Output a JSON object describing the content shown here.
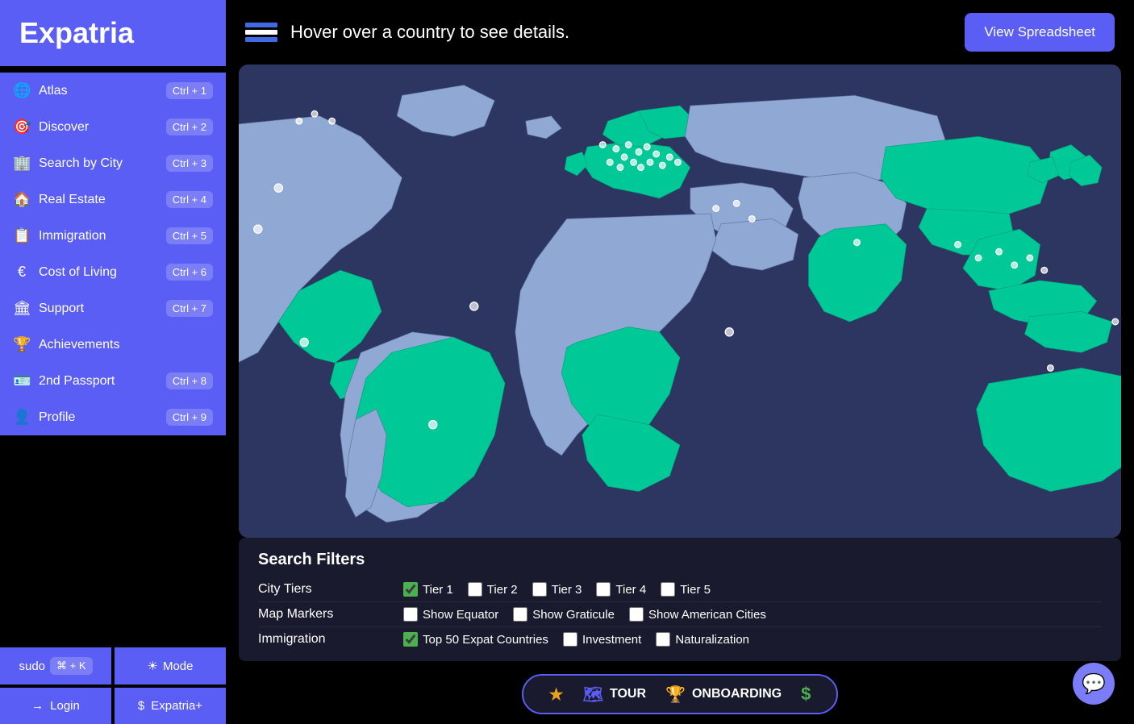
{
  "app": {
    "logo": "Expatria"
  },
  "sidebar": {
    "items": [
      {
        "id": "atlas",
        "label": "Atlas",
        "icon": "🌐",
        "shortcut": "Ctrl + 1"
      },
      {
        "id": "discover",
        "label": "Discover",
        "icon": "🎯",
        "shortcut": "Ctrl + 2"
      },
      {
        "id": "search-by-city",
        "label": "Search by City",
        "icon": "🏢",
        "shortcut": "Ctrl + 3"
      },
      {
        "id": "real-estate",
        "label": "Real Estate",
        "icon": "🏠",
        "shortcut": "Ctrl + 4"
      },
      {
        "id": "immigration",
        "label": "Immigration",
        "icon": "📋",
        "shortcut": "Ctrl + 5"
      },
      {
        "id": "cost-of-living",
        "label": "Cost of Living",
        "icon": "€",
        "shortcut": "Ctrl + 6"
      },
      {
        "id": "support",
        "label": "Support",
        "icon": "🏛",
        "shortcut": "Ctrl + 7"
      },
      {
        "id": "achievements",
        "label": "Achievements",
        "icon": "🏆",
        "shortcut": null
      },
      {
        "id": "2nd-passport",
        "label": "2nd Passport",
        "icon": "🪪",
        "shortcut": "Ctrl + 8"
      },
      {
        "id": "profile",
        "label": "Profile",
        "icon": "👤",
        "shortcut": "Ctrl + 9"
      }
    ],
    "sudo_label": "sudo",
    "sudo_shortcut": "⌘ + K",
    "mode_label": "Mode",
    "login_label": "Login",
    "expatria_plus_label": "Expatria+"
  },
  "topbar": {
    "hint": "Hover over a country to see details.",
    "view_spreadsheet_label": "View Spreadsheet"
  },
  "filters": {
    "title": "Search Filters",
    "rows": [
      {
        "label": "City Tiers",
        "options": [
          {
            "id": "tier1",
            "label": "Tier 1",
            "checked": true
          },
          {
            "id": "tier2",
            "label": "Tier 2",
            "checked": false
          },
          {
            "id": "tier3",
            "label": "Tier 3",
            "checked": false
          },
          {
            "id": "tier4",
            "label": "Tier 4",
            "checked": false
          },
          {
            "id": "tier5",
            "label": "Tier 5",
            "checked": false
          }
        ]
      },
      {
        "label": "Map Markers",
        "options": [
          {
            "id": "show-equator",
            "label": "Show Equator",
            "checked": false
          },
          {
            "id": "show-graticule",
            "label": "Show Graticule",
            "checked": false
          },
          {
            "id": "show-american-cities",
            "label": "Show American Cities",
            "checked": false
          }
        ]
      },
      {
        "label": "Immigration",
        "options": [
          {
            "id": "top50-expat",
            "label": "Top 50 Expat Countries",
            "checked": true
          },
          {
            "id": "investment",
            "label": "Investment",
            "checked": false
          },
          {
            "id": "naturalization",
            "label": "Naturalization",
            "checked": false
          }
        ]
      }
    ]
  },
  "bottom_toolbar": {
    "buttons": [
      {
        "id": "star",
        "icon": "★",
        "label": "",
        "class": "star"
      },
      {
        "id": "tour",
        "icon": "🗺",
        "label": "TOUR",
        "class": "tour"
      },
      {
        "id": "onboarding",
        "icon": "🏆",
        "label": "ONBOARDING",
        "class": "onboarding"
      },
      {
        "id": "dollar",
        "icon": "$",
        "label": "",
        "class": "dollar"
      }
    ]
  },
  "chat": {
    "icon": "💬"
  }
}
